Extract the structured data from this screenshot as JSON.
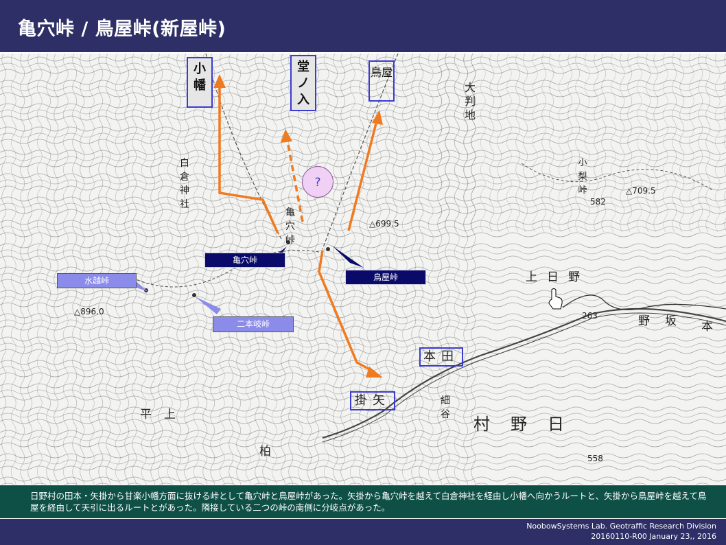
{
  "header": {
    "title": "亀穴峠 / 鳥屋峠(新屋峠)"
  },
  "map": {
    "destinations": {
      "obata": "小幡",
      "donoiri": "堂ノ入",
      "toya": "鳥屋"
    },
    "places": {
      "hond": "本田",
      "yakake": "掛矢"
    },
    "pass_labels": {
      "kameana": "亀穴峠",
      "toya": "鳥屋峠",
      "mizukoshi": "水越峠",
      "nihonmata": "二本岐峠"
    },
    "unknown_marker": "?",
    "map_text": {
      "oobanchi": "大判地",
      "shirakura": "白倉神社",
      "kameana_vert": "亀穴峠",
      "elev_699": "△699.5",
      "elev_7095": "△709.5",
      "elev_896": "△896.0",
      "elev_582": "582",
      "elev_263": "263",
      "elev_558": "558",
      "koriyama": "小梨峠",
      "kamihino": "上日野",
      "noboru": "野坂",
      "hirakami": "平上",
      "kashiwa": "柏",
      "hino_village": "村野日",
      "hosoya": "細谷",
      "hon": "本"
    },
    "arrow_color": "#f07a20"
  },
  "caption": {
    "text": "日野村の田本・矢掛から甘楽小幡方面に抜ける峠として亀穴峠と鳥屋峠があった。矢掛から亀穴峠を越えて白倉神社を経由し小幡へ向かうルートと、矢掛から鳥屋峠を越えて鳥屋を経由して天引に出るルートとがあった。隣接している二つの峠の南側に分岐点があった。"
  },
  "footer": {
    "credit_line1": "NoobowSystems Lab. Geotraffic Research Division",
    "credit_line2": "20160110-R00 January 23,, 2016"
  }
}
